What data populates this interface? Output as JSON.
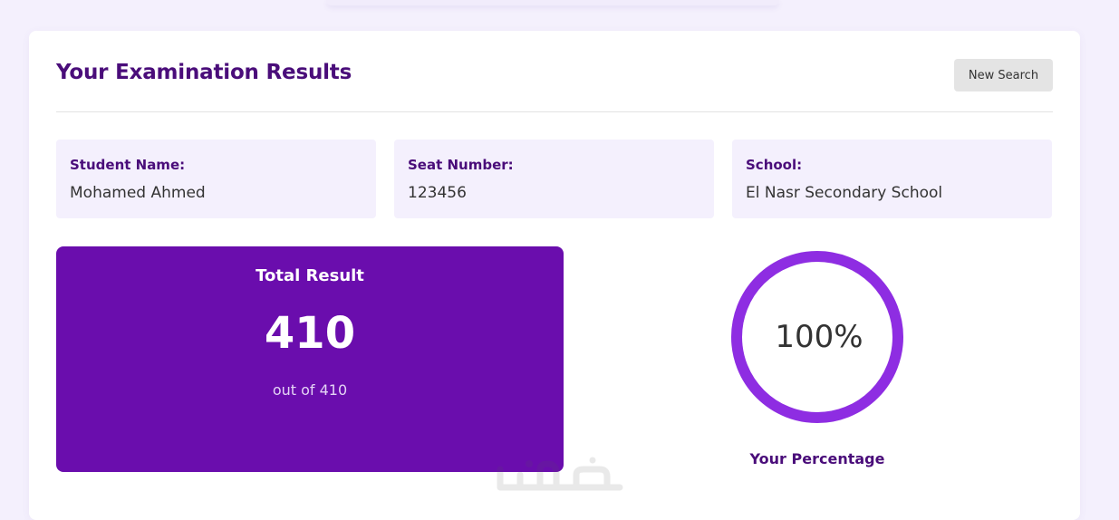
{
  "header": {
    "title": "Your Examination Results",
    "new_search_label": "New Search"
  },
  "student": {
    "name_label": "Student Name:",
    "name": "Mohamed Ahmed",
    "seat_label": "Seat Number:",
    "seat": "123456",
    "school_label": "School:",
    "school": "El Nasr Secondary School"
  },
  "result": {
    "title": "Total Result",
    "score": "410",
    "out_of": "out of 410"
  },
  "percentage": {
    "value": 100,
    "display": "100%",
    "label": "Your Percentage"
  },
  "colors": {
    "accent": "#6a0dad",
    "heading": "#4a0d7a",
    "ring": "#8e2de2",
    "background": "#f4f0fd"
  },
  "icons": {
    "watermark": "khamsat-logo"
  }
}
